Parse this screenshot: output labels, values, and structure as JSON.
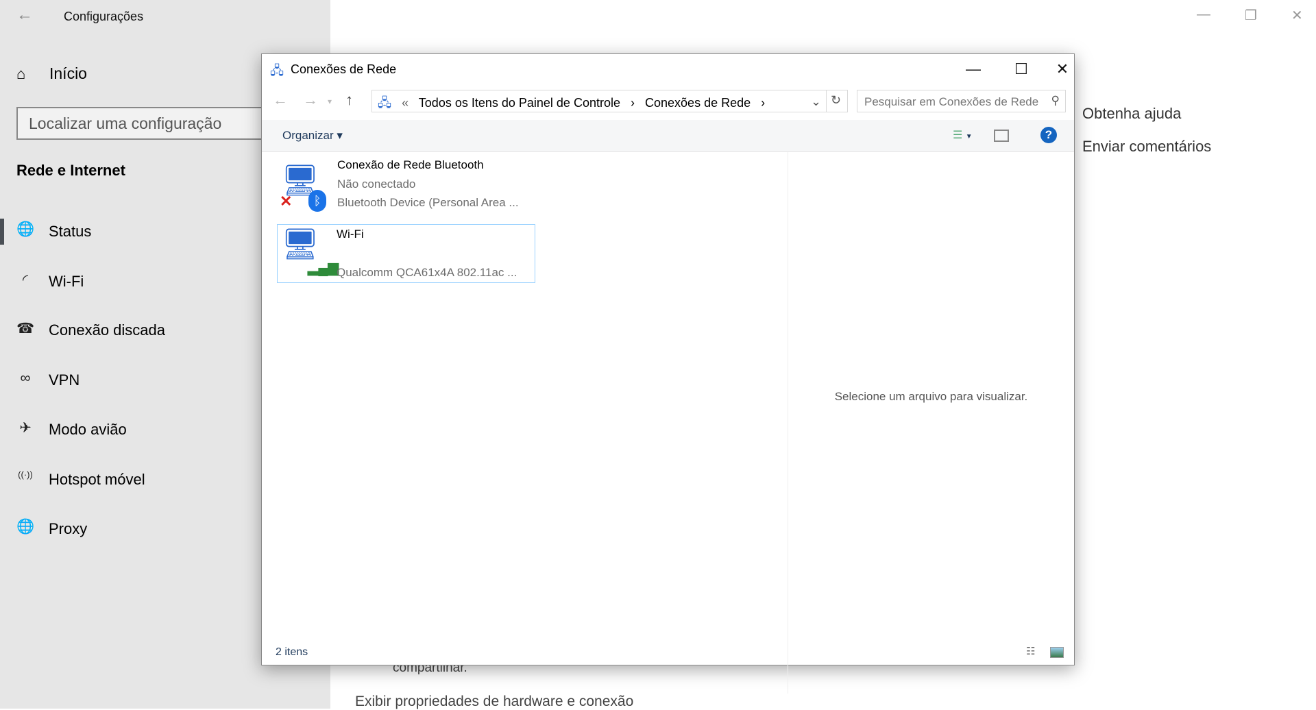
{
  "settings": {
    "title": "Configurações",
    "home": "Início",
    "search_placeholder": "Localizar uma configuração",
    "section": "Rede e Internet",
    "nav": [
      {
        "label": "Status",
        "icon": "globe-icon"
      },
      {
        "label": "Wi-Fi",
        "icon": "wifi-icon"
      },
      {
        "label": "Conexão discada",
        "icon": "dialup-icon"
      },
      {
        "label": "VPN",
        "icon": "vpn-icon"
      },
      {
        "label": "Modo avião",
        "icon": "airplane-icon"
      },
      {
        "label": "Hotspot móvel",
        "icon": "hotspot-icon"
      },
      {
        "label": "Proxy",
        "icon": "globe-icon"
      }
    ],
    "selected": "Status",
    "help": "Obtenha ajuda",
    "feedback": "Enviar comentários",
    "bg_text1": "compartilhar.",
    "bg_text2": "Exibir propriedades de hardware e conexão"
  },
  "explorer": {
    "title": "Conexões de Rede",
    "breadcrumb": [
      "«",
      "Todos os Itens do Painel de Controle",
      "›",
      "Conexões de Rede",
      "›"
    ],
    "search_placeholder": "Pesquisar em Conexões de Rede",
    "organize": "Organizar",
    "items": [
      {
        "name": "Conexão de Rede Bluetooth",
        "status": "Não conectado",
        "device": "Bluetooth Device (Personal Area ..."
      },
      {
        "name": "Wi-Fi",
        "status": "",
        "device": "Qualcomm QCA61x4A 802.11ac ..."
      }
    ],
    "preview_text": "Selecione um arquivo para visualizar.",
    "status_count": "2 itens"
  }
}
